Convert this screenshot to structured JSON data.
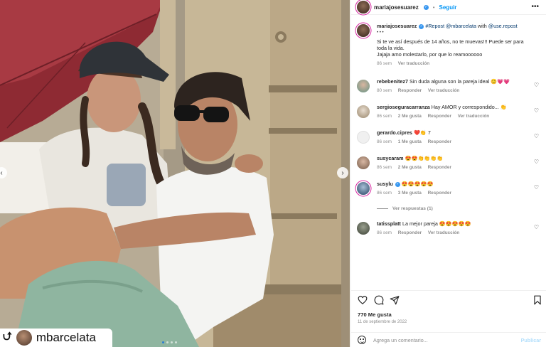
{
  "header": {
    "username": "mariajosesuarez",
    "separator": "•",
    "follow_label": "Seguir",
    "more_icon": "more-horizontal-icon"
  },
  "photo": {
    "repost_overlay_name": "mbarcelata",
    "repost_icon": "repost-icon"
  },
  "caption": {
    "username": "mariajosesuarez",
    "repost_tag": "#Repost",
    "mention_1": "@mbarcelata",
    "with_word": "with",
    "mention_2": "@use.repost",
    "ellipsis": "• • •",
    "line_1": "Si te ve así después de 14 años, no te muevas!!! Puede ser para toda la vida.",
    "line_2": "Jajaja amo molestarlo, por que lo reamoooooo",
    "time": "86 sem",
    "translate": "Ver traducción"
  },
  "comments": [
    {
      "username": "rebebenitez7",
      "text": "Sin duda alguna son la pareja ideal 😊💗💗",
      "time": "80 sem",
      "likes": "",
      "reply": "Responder",
      "translate": "Ver traducción"
    },
    {
      "username": "sergioseguracarranza",
      "text": "Hay AMOR y correspondido... 👏",
      "time": "86 sem",
      "likes": "2 Me gusta",
      "reply": "Responder",
      "translate": "Ver traducción"
    },
    {
      "username": "gerardo.cipres",
      "text": "❤️👏 7",
      "time": "86 sem",
      "likes": "1 Me gusta",
      "reply": "Responder",
      "translate": ""
    },
    {
      "username": "susycaram",
      "text": "😍😍👏👏👏👏",
      "time": "86 sem",
      "likes": "2 Me gusta",
      "reply": "Responder",
      "translate": ""
    },
    {
      "username": "susylu",
      "text": "😍😍😍😍😍",
      "time": "86 sem",
      "likes": "3 Me gusta",
      "reply": "Responder",
      "translate": ""
    },
    {
      "username": "tatissplatt",
      "text": "La mejor pareja 😍😍😍😍😍",
      "time": "86 sem",
      "likes": "",
      "reply": "Responder",
      "translate": "Ver traducción"
    }
  ],
  "view_replies": "Ver respuestas (1)",
  "actions": {
    "likes": "770 Me gusta",
    "date": "11 de septiembre de 2022"
  },
  "add_comment": {
    "placeholder": "Agrega un comentario...",
    "publish": "Publicar"
  },
  "colors": {
    "link": "#00376b",
    "follow": "#0095f6",
    "muted": "#8e8e8e",
    "verified": "#3897f0"
  }
}
